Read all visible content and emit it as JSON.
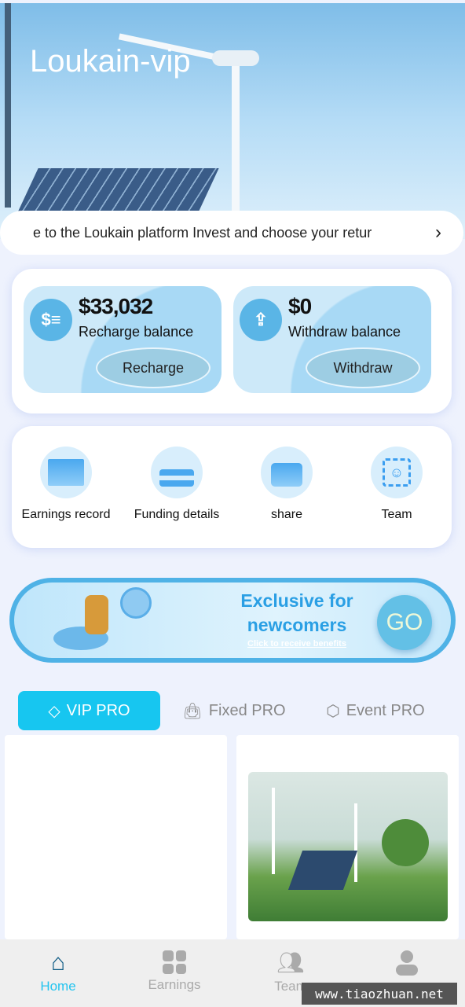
{
  "header": {
    "title": "Loukain-vip"
  },
  "notice": {
    "text": "e to the Loukain platform Invest and choose your retur",
    "icon": "chevron-right-icon"
  },
  "balances": [
    {
      "amount": "$33,032",
      "label": "Recharge balance",
      "button": "Recharge",
      "icon": "receipt-icon"
    },
    {
      "amount": "$0",
      "label": "Withdraw balance",
      "button": "Withdraw",
      "icon": "withdraw-card-icon"
    }
  ],
  "menu": [
    {
      "label": "Earnings record",
      "icon": "wallet-icon"
    },
    {
      "label": "Funding details",
      "icon": "upload-stack-icon"
    },
    {
      "label": "share",
      "icon": "briefcase-icon"
    },
    {
      "label": "Team",
      "icon": "user-scan-icon"
    }
  ],
  "banner": {
    "heading": "Exclusive for newcomers",
    "sub": "Click to receive benefits",
    "go": "GO"
  },
  "tabs": [
    {
      "label": "VIP PRO",
      "icon": "diamond-v-icon",
      "active": true
    },
    {
      "label": "Fixed PRO",
      "icon": "bag-icon",
      "active": false
    },
    {
      "label": "Event PRO",
      "icon": "box-icon",
      "active": false
    }
  ],
  "nav": [
    {
      "label": "Home",
      "icon": "home-icon",
      "active": true
    },
    {
      "label": "Earnings",
      "icon": "grid-icon",
      "active": false
    },
    {
      "label": "Team",
      "icon": "team-icon",
      "active": false
    },
    {
      "label": "",
      "icon": "user-icon",
      "active": false
    }
  ],
  "watermark": "www.tiaozhuan.net",
  "colors": {
    "accent": "#17c6f0",
    "banner": "#2a9fe4",
    "nav_active": "#24c4ef"
  }
}
